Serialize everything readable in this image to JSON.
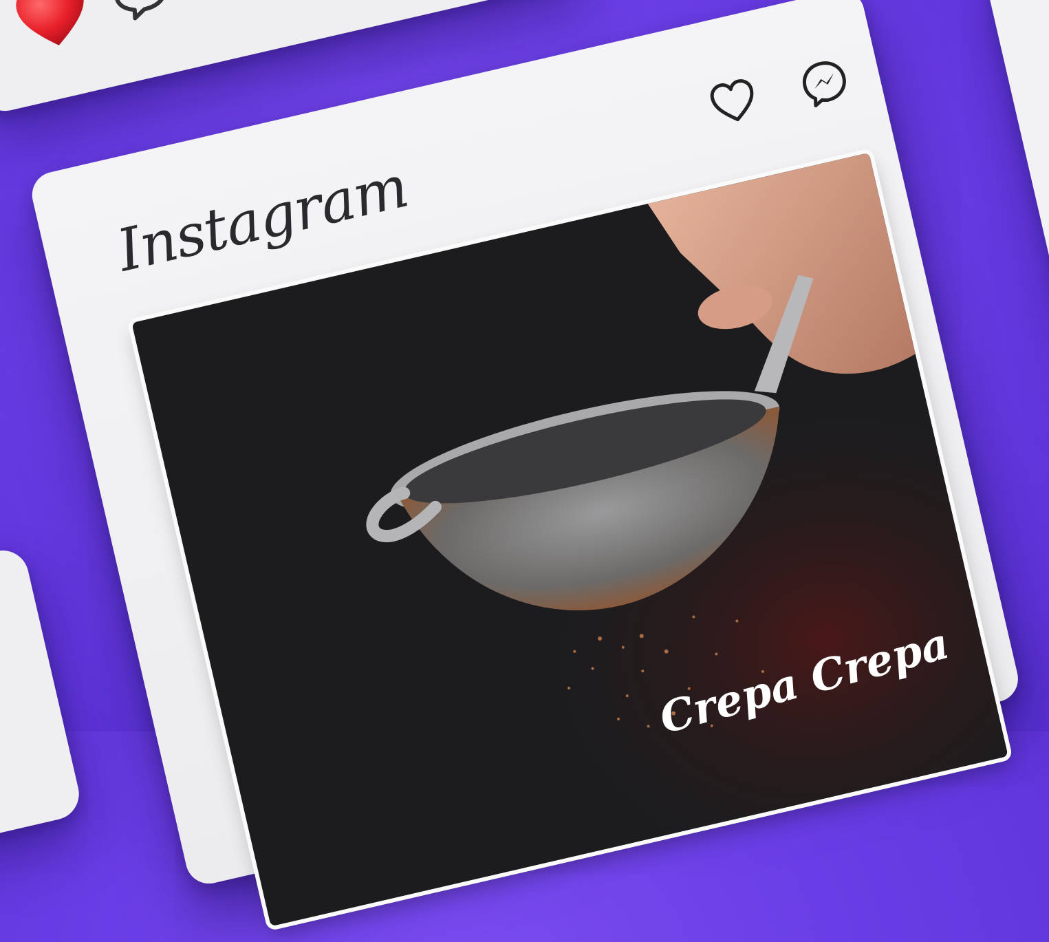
{
  "app": {
    "logo_text": "Instagram"
  },
  "post": {
    "caption": "Crepa Crepa"
  },
  "colors": {
    "background": "#6a3ee6",
    "card": "#efeff1",
    "post_bg": "#1c1c1e",
    "heart_red": "#e8202a"
  },
  "icons": {
    "like": "heart-icon",
    "messages": "messenger-icon",
    "liked": "heart-filled-icon",
    "comment": "comment-icon"
  }
}
